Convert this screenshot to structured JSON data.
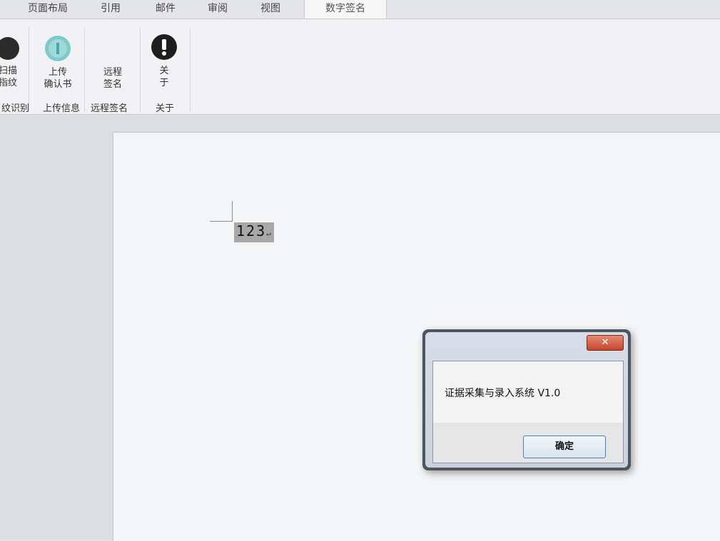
{
  "tabs": [
    {
      "label": "页面布局"
    },
    {
      "label": "引用"
    },
    {
      "label": "邮件"
    },
    {
      "label": "审阅"
    },
    {
      "label": "视图"
    },
    {
      "label": "数字签名",
      "active": true
    }
  ],
  "ribbon": {
    "buttons": [
      {
        "line1": "扫描",
        "line2": "指纹",
        "icon": "fingerprint-icon"
      },
      {
        "line1": "上传",
        "line2": "确认书",
        "icon": "upload-icon"
      },
      {
        "line1": "远程",
        "line2": "签名",
        "icon": ""
      },
      {
        "line1": "关",
        "line2": "于",
        "icon": "info-exclamation-icon"
      }
    ],
    "groups": [
      {
        "label": "纹识别"
      },
      {
        "label": "上传信息"
      },
      {
        "label": "远程签名"
      },
      {
        "label": "关于"
      }
    ]
  },
  "document": {
    "text": "123",
    "paragraph_mark": "↵"
  },
  "dialog": {
    "close_label": "✕",
    "message": "证据采集与录入系统 V1.0",
    "ok_label": "确定"
  },
  "colors": {
    "dialog_frame": "#4b5663",
    "close_button": "#c5452b",
    "ok_border": "#3f84c4",
    "highlight": "#a8a8a8"
  }
}
